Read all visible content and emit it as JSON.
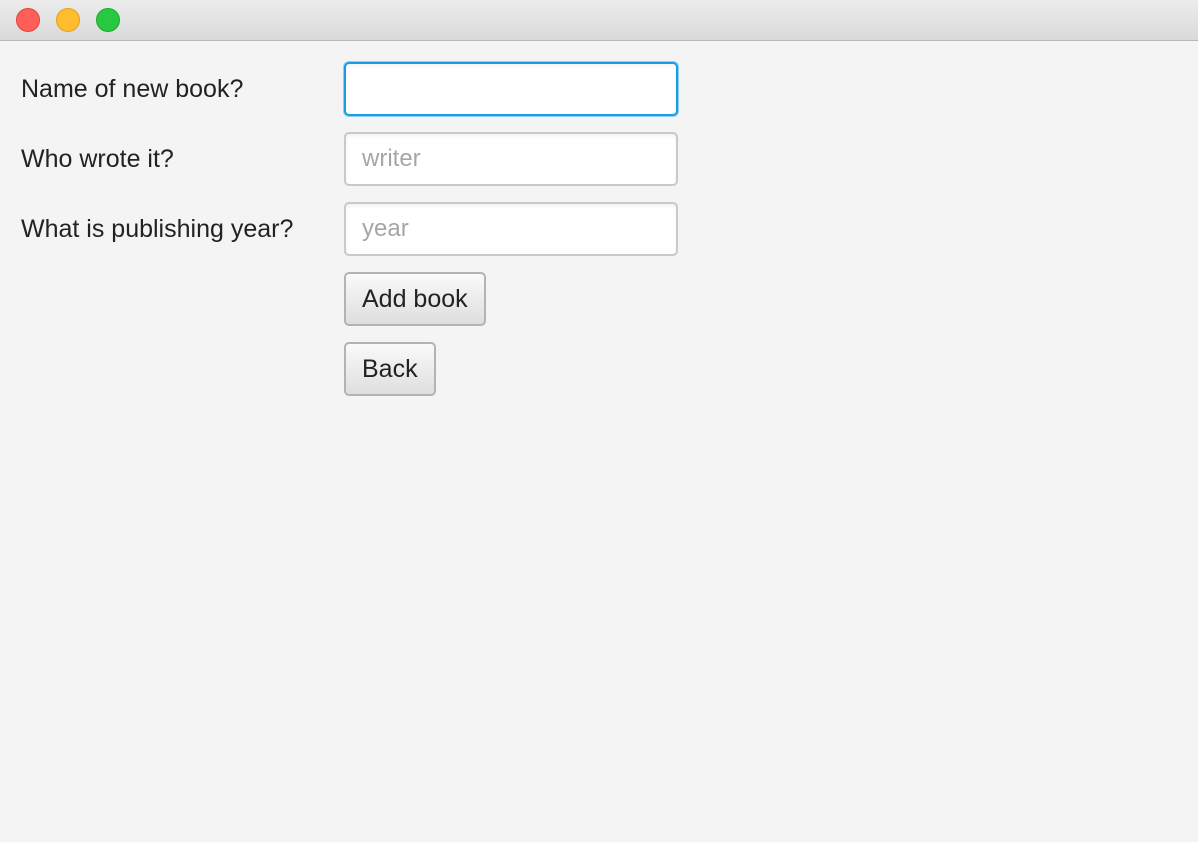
{
  "window": {
    "controls": {
      "close_icon": "close-traffic-light-icon",
      "minimize_icon": "minimize-traffic-light-icon",
      "zoom_icon": "zoom-traffic-light-icon",
      "close_color": "#fe5f57",
      "minimize_color": "#febc2e",
      "zoom_color": "#28c840"
    }
  },
  "form": {
    "book_name": {
      "label": "Name of new book?",
      "value": "",
      "placeholder": "",
      "focused": true
    },
    "writer": {
      "label": "Who wrote it?",
      "value": "",
      "placeholder": "writer"
    },
    "year": {
      "label": "What is publishing year?",
      "value": "",
      "placeholder": "year"
    },
    "add_button_label": "Add book",
    "back_button_label": "Back"
  },
  "colors": {
    "focus_ring": "#1a9be6",
    "background": "#f4f4f4"
  }
}
